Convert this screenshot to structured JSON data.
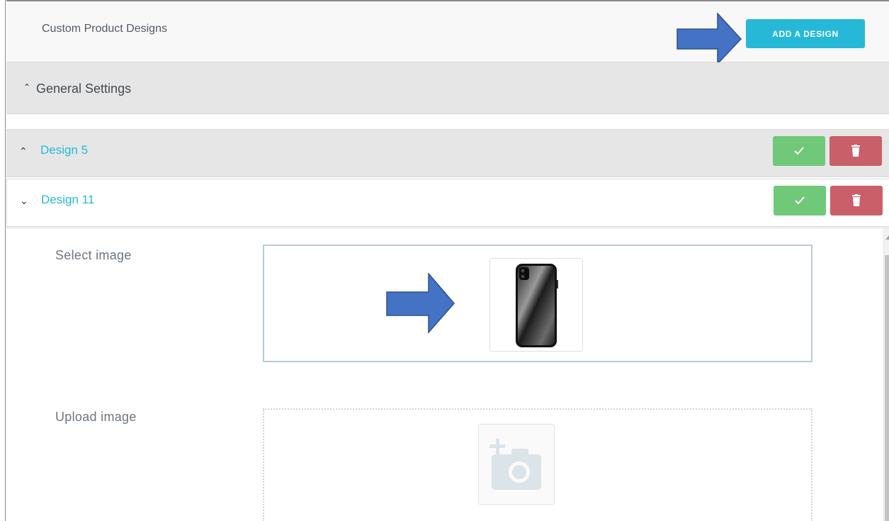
{
  "header": {
    "title": "Custom Product Designs",
    "add_button_label": "ADD A DESIGN"
  },
  "general_settings": {
    "chevron": "⌃",
    "label": "General Settings"
  },
  "designs": [
    {
      "label": "Design 5",
      "chevron": "⌃",
      "expanded": false
    },
    {
      "label": "Design 11",
      "chevron": "⌄",
      "expanded": true
    }
  ],
  "design_detail": {
    "select_image_label": "Select image",
    "upload_image_label": "Upload image"
  },
  "colors": {
    "accent": "#25b9d7",
    "confirm": "#70c879",
    "delete": "#c95f68",
    "annotation_arrow": "#4472c4"
  },
  "icons": {
    "confirm": "check-icon",
    "delete": "trash-icon",
    "upload": "camera-add-icon",
    "annotation": "arrow-right-icon"
  }
}
